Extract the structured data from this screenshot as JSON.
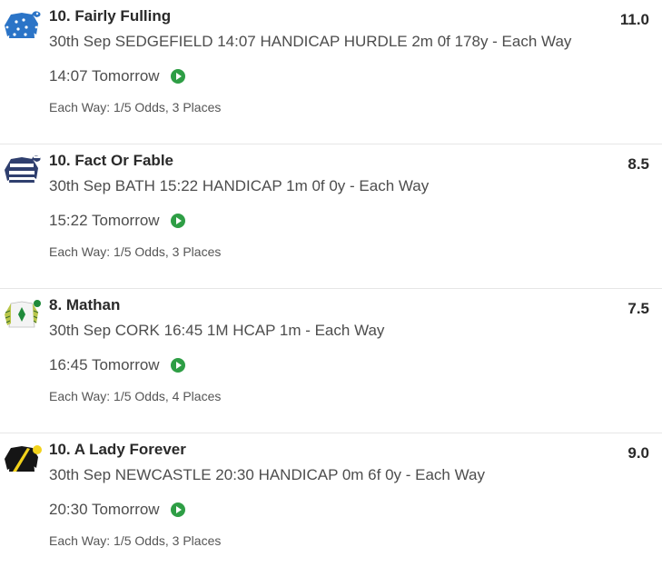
{
  "bets": [
    {
      "title": "10. Fairly Fulling",
      "description": "30th Sep SEDGEFIELD 14:07 HANDICAP HURDLE 2m 0f 178y - Each Way",
      "time": "14:07 Tomorrow",
      "terms": "Each Way: 1/5 Odds, 3 Places",
      "odds": "11.0",
      "silk_icon": "jockey-silk-blue-white-spots-icon"
    },
    {
      "title": "10. Fact Or Fable",
      "description": "30th Sep BATH 15:22 HANDICAP 1m 0f 0y - Each Way",
      "time": "15:22 Tomorrow",
      "terms": "Each Way: 1/5 Odds, 3 Places",
      "odds": "8.5",
      "silk_icon": "jockey-silk-navy-white-hoops-icon"
    },
    {
      "title": "8. Mathan",
      "description": "30th Sep CORK 16:45 1M HCAP 1m - Each Way",
      "time": "16:45 Tomorrow",
      "terms": "Each Way: 1/5 Odds, 4 Places",
      "odds": "7.5",
      "silk_icon": "jockey-silk-white-green-diamond-icon"
    },
    {
      "title": "10. A Lady Forever",
      "description": "30th Sep NEWCASTLE 20:30 HANDICAP 0m 6f 0y - Each Way",
      "time": "20:30 Tomorrow",
      "terms": "Each Way: 1/5 Odds, 3 Places",
      "odds": "9.0",
      "silk_icon": "jockey-silk-black-yellow-sash-icon"
    }
  ],
  "colors": {
    "play_button": "#2e9e45",
    "text_dark": "#2a2a2a",
    "text_mid": "#4d4d4d",
    "divider": "#e6e6e6"
  }
}
